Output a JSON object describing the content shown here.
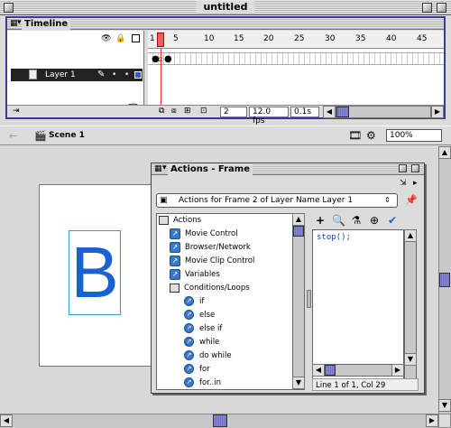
{
  "window": {
    "title": "untitled"
  },
  "timeline": {
    "panel_title": "Timeline",
    "layer_name": "Layer 1",
    "frame_ticks": [
      "1",
      "5",
      "10",
      "15",
      "20",
      "25",
      "30",
      "35",
      "40",
      "45"
    ],
    "status": {
      "current_frame": "2",
      "fps": "12.0 fps",
      "elapsed": "0.1s"
    }
  },
  "editbar": {
    "scene": "Scene 1",
    "zoom": "100%"
  },
  "stage": {
    "letter": "B",
    "letter_color": "#1a62d2"
  },
  "actions": {
    "panel_title": "Actions - Frame",
    "selector": "Actions for Frame 2 of Layer Name Layer 1",
    "tree": [
      {
        "label": "Actions",
        "kind": "book"
      },
      {
        "label": "Movie Control",
        "kind": "category"
      },
      {
        "label": "Browser/Network",
        "kind": "category"
      },
      {
        "label": "Movie Clip Control",
        "kind": "category"
      },
      {
        "label": "Variables",
        "kind": "category"
      },
      {
        "label": "Conditions/Loops",
        "kind": "book-open"
      },
      {
        "label": "if",
        "kind": "action"
      },
      {
        "label": "else",
        "kind": "action"
      },
      {
        "label": "else if",
        "kind": "action"
      },
      {
        "label": "while",
        "kind": "action"
      },
      {
        "label": "do while",
        "kind": "action"
      },
      {
        "label": "for",
        "kind": "action"
      },
      {
        "label": "for..in",
        "kind": "action"
      }
    ],
    "code": "stop();",
    "status": "Line 1 of 1, Col 29"
  },
  "colors": {
    "accent": "#3a3a9a",
    "icon_blue": "#3a78c8"
  }
}
